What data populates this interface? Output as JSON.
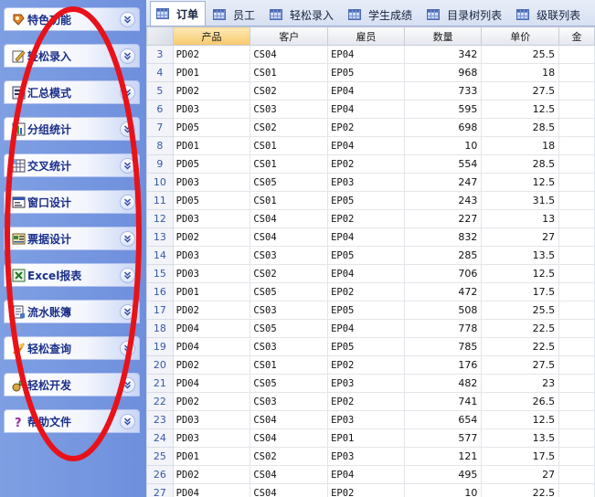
{
  "sidebar": {
    "items": [
      {
        "label": "特色功能",
        "icon": "feature-icon"
      },
      {
        "label": "轻松录入",
        "icon": "entry-icon"
      },
      {
        "label": "汇总模式",
        "icon": "summary-icon"
      },
      {
        "label": "分组统计",
        "icon": "group-stats-icon"
      },
      {
        "label": "交叉统计",
        "icon": "cross-stats-icon"
      },
      {
        "label": "窗口设计",
        "icon": "window-design-icon"
      },
      {
        "label": "票据设计",
        "icon": "receipt-design-icon"
      },
      {
        "label": "Excel报表",
        "icon": "excel-icon"
      },
      {
        "label": "流水账簿",
        "icon": "ledger-icon"
      },
      {
        "label": "轻松查询",
        "icon": "query-icon"
      },
      {
        "label": "轻松开发",
        "icon": "develop-icon"
      },
      {
        "label": "帮助文件",
        "icon": "help-icon"
      }
    ]
  },
  "tabs": [
    {
      "label": "订单",
      "active": true
    },
    {
      "label": "员工",
      "active": false
    },
    {
      "label": "轻松录入",
      "active": false
    },
    {
      "label": "学生成绩",
      "active": false
    },
    {
      "label": "目录树列表",
      "active": false
    },
    {
      "label": "级联列表",
      "active": false
    }
  ],
  "grid": {
    "columns": [
      "产品",
      "客户",
      "雇员",
      "数量",
      "单价",
      "金"
    ],
    "rows": [
      {
        "n": "3",
        "product": "PD02",
        "customer": "CS04",
        "employee": "EP04",
        "qty": "342",
        "price": "25.5"
      },
      {
        "n": "4",
        "product": "PD01",
        "customer": "CS01",
        "employee": "EP05",
        "qty": "968",
        "price": "18"
      },
      {
        "n": "5",
        "product": "PD02",
        "customer": "CS02",
        "employee": "EP04",
        "qty": "733",
        "price": "27.5"
      },
      {
        "n": "6",
        "product": "PD03",
        "customer": "CS03",
        "employee": "EP04",
        "qty": "595",
        "price": "12.5"
      },
      {
        "n": "7",
        "product": "PD05",
        "customer": "CS02",
        "employee": "EP02",
        "qty": "698",
        "price": "28.5"
      },
      {
        "n": "8",
        "product": "PD01",
        "customer": "CS01",
        "employee": "EP04",
        "qty": "10",
        "price": "18"
      },
      {
        "n": "9",
        "product": "PD05",
        "customer": "CS01",
        "employee": "EP02",
        "qty": "554",
        "price": "28.5"
      },
      {
        "n": "10",
        "product": "PD03",
        "customer": "CS05",
        "employee": "EP03",
        "qty": "247",
        "price": "12.5"
      },
      {
        "n": "11",
        "product": "PD05",
        "customer": "CS01",
        "employee": "EP05",
        "qty": "243",
        "price": "31.5"
      },
      {
        "n": "12",
        "product": "PD03",
        "customer": "CS04",
        "employee": "EP02",
        "qty": "227",
        "price": "13"
      },
      {
        "n": "13",
        "product": "PD02",
        "customer": "CS04",
        "employee": "EP04",
        "qty": "832",
        "price": "27"
      },
      {
        "n": "14",
        "product": "PD03",
        "customer": "CS03",
        "employee": "EP05",
        "qty": "285",
        "price": "13.5"
      },
      {
        "n": "15",
        "product": "PD03",
        "customer": "CS02",
        "employee": "EP04",
        "qty": "706",
        "price": "12.5"
      },
      {
        "n": "16",
        "product": "PD01",
        "customer": "CS05",
        "employee": "EP02",
        "qty": "472",
        "price": "17.5"
      },
      {
        "n": "17",
        "product": "PD02",
        "customer": "CS03",
        "employee": "EP05",
        "qty": "508",
        "price": "25.5"
      },
      {
        "n": "18",
        "product": "PD04",
        "customer": "CS05",
        "employee": "EP04",
        "qty": "778",
        "price": "22.5"
      },
      {
        "n": "19",
        "product": "PD04",
        "customer": "CS03",
        "employee": "EP05",
        "qty": "785",
        "price": "22.5"
      },
      {
        "n": "20",
        "product": "PD02",
        "customer": "CS01",
        "employee": "EP02",
        "qty": "176",
        "price": "27.5"
      },
      {
        "n": "21",
        "product": "PD04",
        "customer": "CS05",
        "employee": "EP03",
        "qty": "482",
        "price": "23"
      },
      {
        "n": "22",
        "product": "PD02",
        "customer": "CS03",
        "employee": "EP02",
        "qty": "741",
        "price": "26.5"
      },
      {
        "n": "23",
        "product": "PD03",
        "customer": "CS04",
        "employee": "EP03",
        "qty": "654",
        "price": "12.5"
      },
      {
        "n": "24",
        "product": "PD03",
        "customer": "CS04",
        "employee": "EP01",
        "qty": "577",
        "price": "13.5"
      },
      {
        "n": "25",
        "product": "PD01",
        "customer": "CS02",
        "employee": "EP03",
        "qty": "121",
        "price": "17.5"
      },
      {
        "n": "26",
        "product": "PD02",
        "customer": "CS04",
        "employee": "EP04",
        "qty": "495",
        "price": "27"
      },
      {
        "n": "27",
        "product": "PD04",
        "customer": "CS04",
        "employee": "EP02",
        "qty": "10",
        "price": "22.5"
      }
    ]
  },
  "colors": {
    "sidebar_bg": "#7f9fe3",
    "nav_text": "#1a2f8a",
    "sorted_header": "#f6c96b",
    "annotation": "#e8121a"
  }
}
